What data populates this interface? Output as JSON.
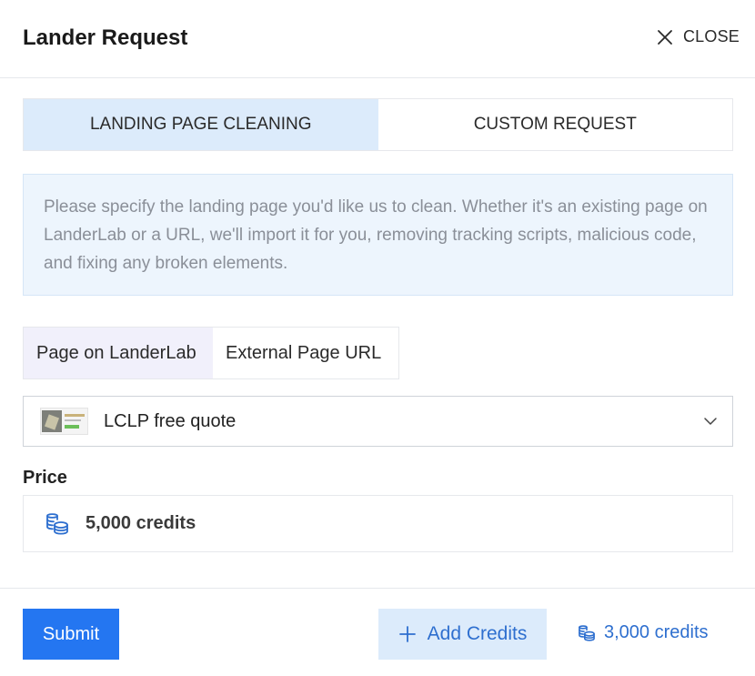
{
  "dialog": {
    "title": "Lander Request",
    "close_label": "CLOSE"
  },
  "tabs": [
    {
      "label": "LANDING PAGE CLEANING",
      "active": true
    },
    {
      "label": "CUSTOM REQUEST",
      "active": false
    }
  ],
  "info": {
    "text": "Please specify the landing page you'd like us to clean. Whether it's an existing page on LanderLab or a URL, we'll import it for you, removing tracking scripts, malicious code, and fixing any broken elements."
  },
  "source_tabs": [
    {
      "label": "Page on LanderLab",
      "active": true
    },
    {
      "label": "External Page URL",
      "active": false
    }
  ],
  "page_select": {
    "selected": "LCLP free quote"
  },
  "price": {
    "label": "Price",
    "value": "5,000 credits"
  },
  "footer": {
    "submit_label": "Submit",
    "add_credits_label": "Add Credits",
    "balance": "3,000 credits"
  },
  "colors": {
    "primary": "#2476f1",
    "accent_text": "#2e6fcf",
    "active_tab_bg": "#dcebfb",
    "info_bg": "#edf5fd"
  },
  "icons": {
    "close": "close-icon",
    "chevron": "chevron-down-icon",
    "coins": "coins-icon",
    "plus": "plus-icon"
  }
}
